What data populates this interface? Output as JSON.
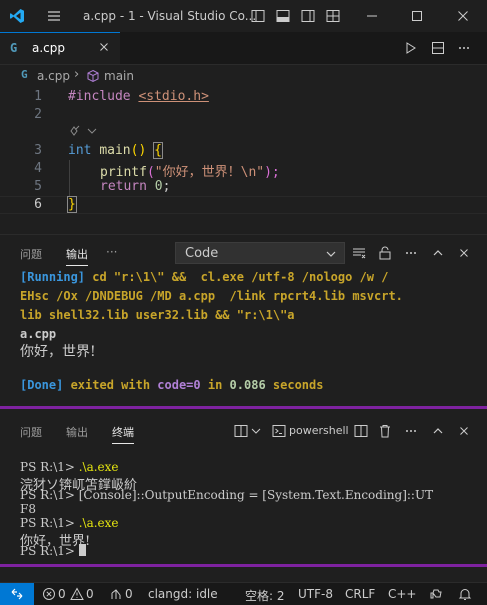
{
  "titlebar": {
    "title": "a.cpp - 1 - Visual Studio Co...",
    "icons": [
      "vscode-logo",
      "menu-icon",
      "layout-sidebar-icon",
      "layout-panel-icon",
      "layout-auxbar-icon",
      "layout-custom-icon",
      "minimize-icon",
      "maximize-icon",
      "close-icon"
    ]
  },
  "tabs": [
    {
      "label": "a.cpp",
      "icon": "cpp-file-icon"
    }
  ],
  "editor_actions": [
    "run-icon",
    "split-editor-icon",
    "more-icon"
  ],
  "breadcrumb": {
    "file": "a.cpp",
    "symbol": "main"
  },
  "editor": {
    "lines": [
      "1",
      "2",
      "",
      "3",
      "4",
      "5",
      "6"
    ],
    "code": {
      "l1_kw": "#include",
      "l1_lib": "<stdio.h>",
      "l3_type": "int",
      "l3_fn": "main",
      "l3_paren": "()",
      "l3_brace": "{",
      "l4_fn": "printf",
      "l4_open": "(",
      "l4_str": "\"你好，世界！\\n\"",
      "l4_close": ");",
      "l5_kw": "return",
      "l5_num": "0",
      "l5_semi": ";",
      "l6_brace": "}"
    }
  },
  "output_panel": {
    "tabs": [
      "问题",
      "输出",
      "···"
    ],
    "active_tab": "输出",
    "select_value": "Code",
    "lines": {
      "running_tag": "[Running]",
      "cmd1": " cd \"r:\\1\\\" &&  cl.exe /utf-8 /nologo /w /",
      "cmd2": "EHsc /Ox /DNDEBUG /MD a.cpp  /link rpcrt4.lib msvcrt.",
      "cmd3": "lib shell32.lib user32.lib && \"r:\\1\\\"a",
      "out1": "a.cpp",
      "out2": "你好，世界!",
      "done_tag": "[Done]",
      "done_a": " exited with ",
      "done_code": "code=0",
      "done_b": " in ",
      "done_time": "0.086",
      "done_c": " seconds"
    }
  },
  "terminal_panel": {
    "tabs": [
      "问题",
      "输出",
      "终端"
    ],
    "active_tab": "终端",
    "shell_label": "powershell",
    "lines": {
      "p1": "PS R:\\1> ",
      "c1": ".\\a.exe",
      "o1": "浣犲ソ锛屼笘鐣岋紒",
      "l2": "PS R:\\1> [Console]::OutputEncoding = [System.Text.Encoding]::UT",
      "l3": "F8",
      "p4": "PS R:\\1> ",
      "c4": ".\\a.exe",
      "o4": "你好，世界!",
      "p5": "PS R:\\1> "
    }
  },
  "statusbar": {
    "errors": "0",
    "warnings": "0",
    "ports": "0",
    "clangd": "clangd: idle",
    "spaces": "空格: 2",
    "encoding": "UTF-8",
    "eol": "CRLF",
    "language": "C++"
  },
  "colors": {
    "accent": "#0078d4",
    "keyword_purple": "#c586c0",
    "keyword_blue": "#569cd6",
    "string": "#ce9178",
    "function": "#dcdcaa",
    "number": "#b5cea8",
    "bracket_gold": "#ffd700",
    "output_cyan": "#3a96dd",
    "terminal_yellow": "#e5e510",
    "sash_purple": "#7e22a0"
  }
}
